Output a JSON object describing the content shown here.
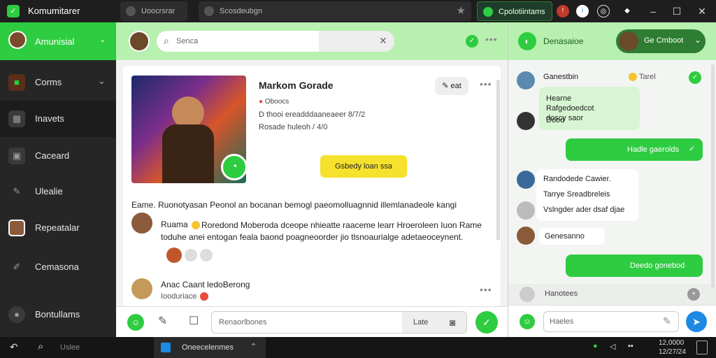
{
  "app": {
    "title": "Komumitarer"
  },
  "tabs": [
    {
      "label": "Uoocrsrar"
    },
    {
      "label": "Scosdeubgn"
    },
    {
      "label": "Cpolotiintams"
    }
  ],
  "sidebar": {
    "header": "Amunisial",
    "items": [
      {
        "label": "Corms",
        "icon": "games-icon"
      },
      {
        "label": "Inavets",
        "icon": "grid-icon"
      },
      {
        "label": "Caceard",
        "icon": "lock-icon"
      },
      {
        "label": "Ulealie",
        "icon": "pen-icon"
      },
      {
        "label": "Repeatalar",
        "icon": "profile-icon"
      },
      {
        "label": "Cemasona",
        "icon": "edit-icon"
      },
      {
        "label": "Bontullams",
        "icon": "community-icon"
      }
    ]
  },
  "middle": {
    "search_placeholder": "Senca",
    "card": {
      "name": "Markom Gorade",
      "meta1": "Oboocs",
      "meta2": "D thooi ereadddaaneaeer 8/7/2",
      "meta3": "Rosade huleoh / 4/0",
      "chip": "eat",
      "action_button": "Gsbedy loan ssa",
      "post_line": "Eame.  Ruonotyasan Peonol an bocanan bemogl paeomolluagnnid illemlanadeole kangi",
      "comment1_user": "Ruama",
      "comment1_text": "Roredond Moberoda dceope nhieatte raaceme learr Hroeroleen Iuon Rame toduhe anei entogan feala baond poagneoorder jio tlsnoaurialge adetaeoceynent.",
      "comment2_user": "Anac Caant ledoBerong",
      "comment2_sub": "Iooduriace"
    },
    "composer_placeholder": "Renaorlbones",
    "composer_button": "Late"
  },
  "right": {
    "header": "Denasaioe",
    "user_chip": "Ge Cmboot",
    "messages": [
      {
        "side": "left",
        "name": "Ganestbin",
        "time": "Tarel",
        "text": "Hearne Rafgedoedcot doscy saor",
        "extra": "Dood"
      },
      {
        "side": "right",
        "text": "Hadle gaerolds"
      },
      {
        "side": "left",
        "name": "Randodede Cawier.",
        "text": "Tarrye Sreadbreleis",
        "extra": "Vslngder ader dsaf djae"
      },
      {
        "side": "left",
        "name": "Genesanno",
        "text": ""
      },
      {
        "side": "right",
        "text": "Deedo gonebod"
      }
    ],
    "typing": "Hanotees",
    "input_placeholder": "Haeles"
  },
  "taskbar": {
    "search": "Uslee",
    "app_label": "Oneecelenmes",
    "time": "12,0000",
    "date": "12/27/24"
  },
  "colors": {
    "accent": "#2ecc40",
    "header_tint": "#b8f0b0",
    "yellow": "#f6e12c"
  }
}
